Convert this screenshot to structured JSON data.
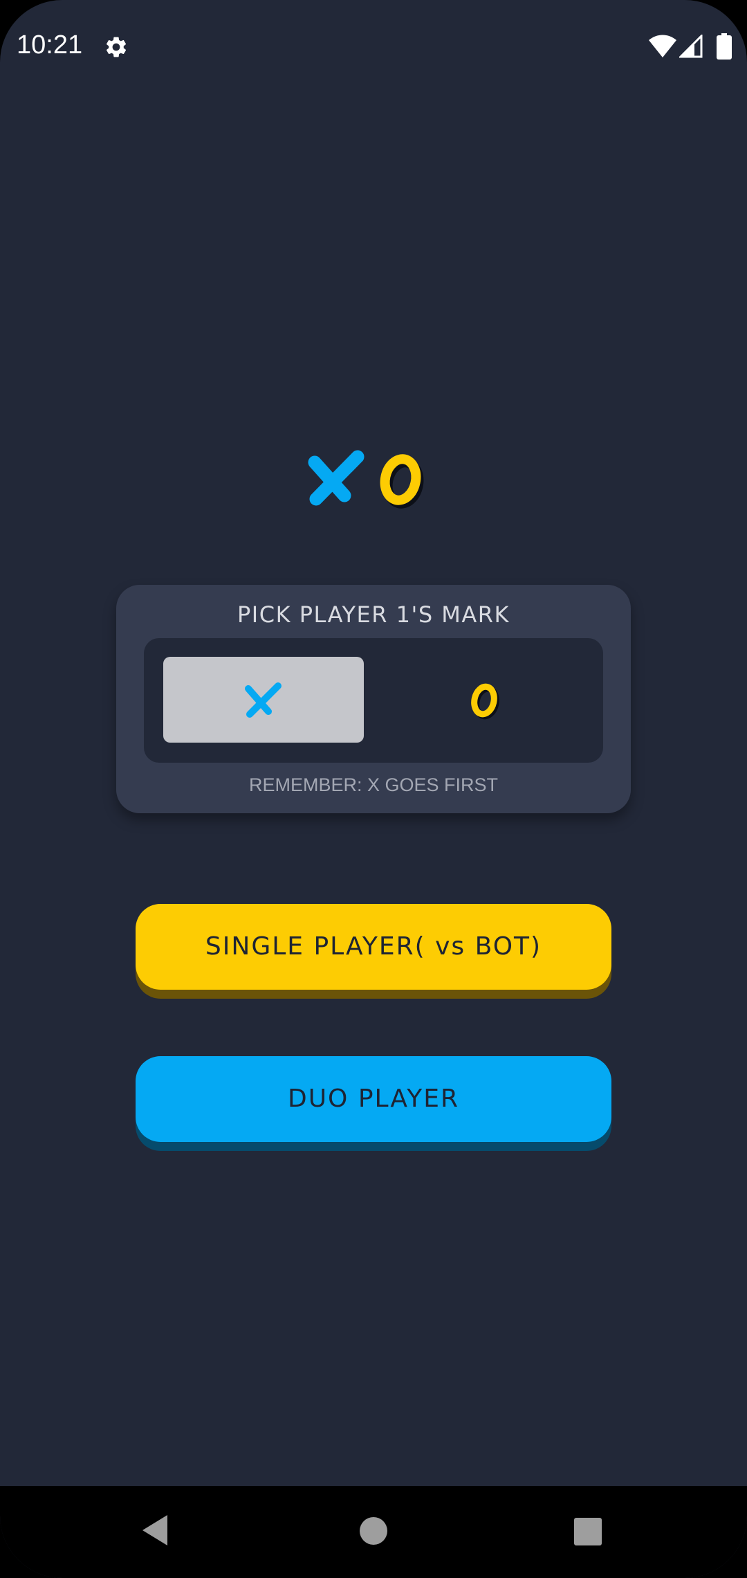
{
  "status_bar": {
    "time": "10:21",
    "icons": [
      "gear-icon",
      "wifi-icon",
      "signal-icon",
      "battery-icon"
    ]
  },
  "logo": {
    "x_symbol": "X",
    "o_symbol": "O",
    "x_color": "#05a9f3",
    "o_color": "#fdcc03"
  },
  "mark_picker": {
    "title": "PICK PLAYER 1'S MARK",
    "options": [
      {
        "symbol": "X",
        "selected": true
      },
      {
        "symbol": "O",
        "selected": false
      }
    ],
    "hint": "REMEMBER: X GOES FIRST"
  },
  "buttons": {
    "single_player": "SINGLE PLAYER( vs BOT)",
    "duo_player": "DUO PLAYER"
  },
  "colors": {
    "background": "#222838",
    "card": "#353c50",
    "accent_yellow": "#fdcc03",
    "accent_blue": "#05a9f3",
    "selected_option": "#c5c6cb"
  },
  "nav_bar": {
    "icons": [
      "back-icon",
      "home-icon",
      "recents-icon"
    ]
  }
}
